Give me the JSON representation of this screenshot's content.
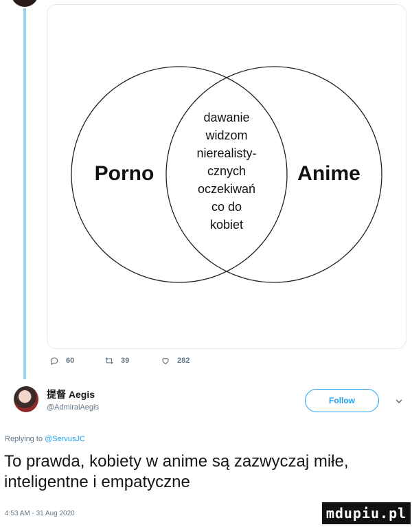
{
  "venn": {
    "left_label": "Porno",
    "right_label": "Anime",
    "overlap_lines": [
      "dawanie",
      "widzom",
      "nierealisty-",
      "cznych",
      "oczekiwań",
      "co do",
      "kobiet"
    ]
  },
  "actions": {
    "reply_count": "60",
    "retweet_count": "39",
    "like_count": "282"
  },
  "author": {
    "display_name": "提督 Aegis",
    "handle": "@AdmiralAegis"
  },
  "follow_label": "Follow",
  "reply": {
    "prefix": "Replying to",
    "mention": "@ServusJC"
  },
  "tweet_text": "To prawda, kobiety w anime są zazwyczaj miłe, inteligentne i empatyczne",
  "timestamp": "4:53 AM - 31 Aug 2020",
  "watermark": "mdupiu.pl",
  "colors": {
    "accent": "#1da1f2",
    "thread_line": "#9ad3ea",
    "muted": "#657786"
  }
}
